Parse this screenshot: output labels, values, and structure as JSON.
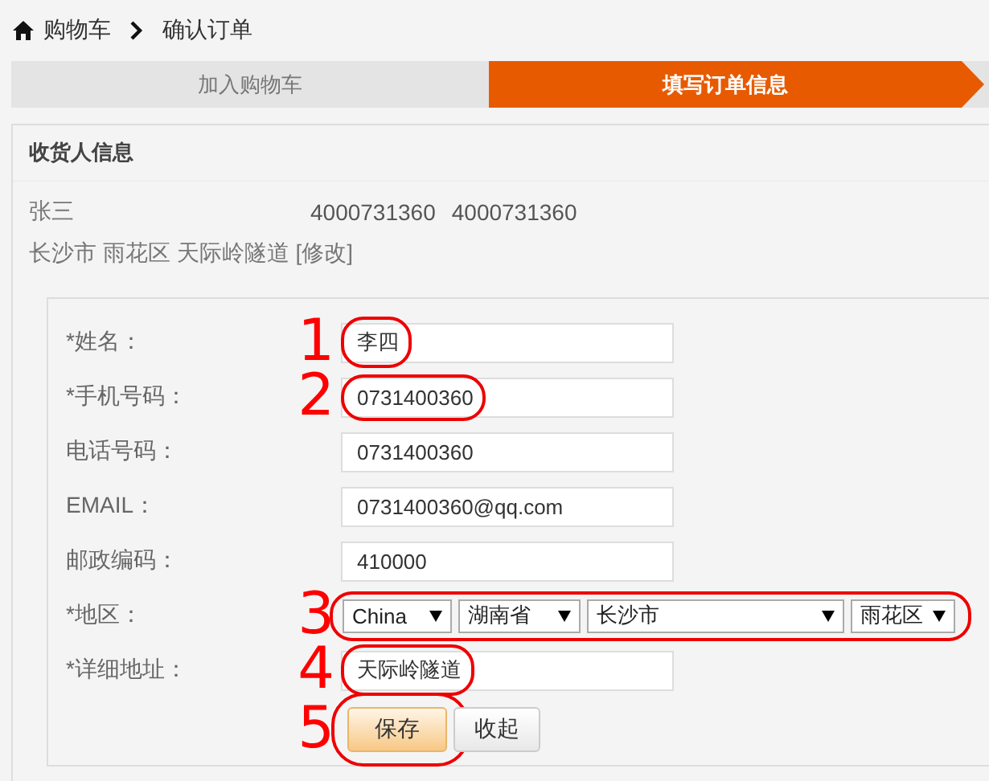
{
  "breadcrumb": [
    {
      "label": "购物车"
    },
    {
      "label": "确认订单"
    }
  ],
  "steps": [
    {
      "label": "加入购物车",
      "selected": false
    },
    {
      "label": "填写订单信息",
      "selected": true
    }
  ],
  "panel": {
    "title": "收货人信息",
    "consignee": {
      "name": "张三",
      "phones": [
        "4000731360",
        "4000731360"
      ],
      "address": "长沙市 雨花区 天际岭隧道",
      "edit_link": "[修改]"
    }
  },
  "form": {
    "rows": [
      {
        "kind": "input",
        "label": "*姓名：",
        "value": "李四",
        "marker": "1"
      },
      {
        "kind": "input",
        "label": "*手机号码：",
        "value": "0731400360",
        "marker": "2"
      },
      {
        "kind": "input",
        "label": "电话号码：",
        "value": "0731400360"
      },
      {
        "kind": "input",
        "label": "EMAIL：",
        "value": "0731400360@qq.com"
      },
      {
        "kind": "input",
        "label": "邮政编码：",
        "value": "410000"
      },
      {
        "kind": "selects",
        "label": "*地区：",
        "selects": [
          "China",
          "湖南省",
          "长沙市",
          "雨花区"
        ],
        "marker": "3"
      },
      {
        "kind": "input",
        "label": "*详细地址：",
        "value": "天际岭隧道",
        "marker": "4"
      },
      {
        "kind": "buttons",
        "buttons": [
          {
            "label": "保存",
            "primary": true
          },
          {
            "label": "收起",
            "primary": false
          }
        ],
        "marker": "5"
      }
    ]
  }
}
